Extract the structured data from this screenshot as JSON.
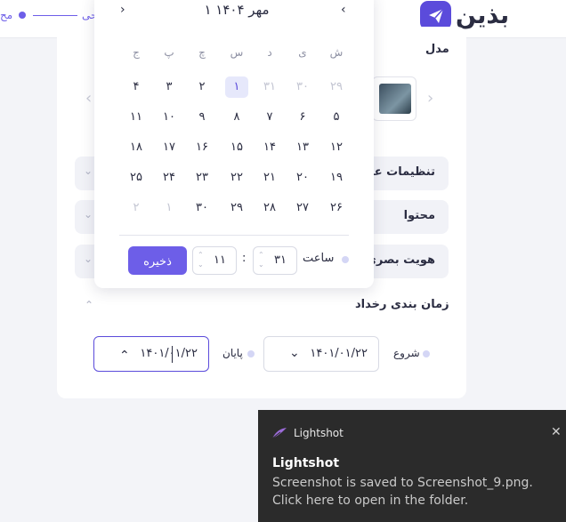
{
  "header": {
    "logo_text": "بذین",
    "step_label_active": "حی",
    "step_label_next": "مح"
  },
  "form": {
    "model_label": "مدل",
    "accordions": [
      {
        "title": "تنظیمات عم"
      },
      {
        "title": "محتوا"
      },
      {
        "title": "هویت بصری"
      }
    ],
    "schedule_title": "زمان بندی رخداد",
    "start_label": "شروع",
    "start_value": "۱۴۰۱/۰۱/۲۲",
    "end_label": "پایان",
    "end_value": "۱۴۰۱/۰۱/۲۲"
  },
  "calendar": {
    "title": "۱ مهر ۱۴۰۴",
    "prev_icon": "›",
    "next_icon": "‹",
    "weekdays": [
      "ش",
      "ی",
      "د",
      "س",
      "چ",
      "پ",
      "ج"
    ],
    "weeks": [
      [
        "۲۹",
        "۳۰",
        "۳۱",
        "۱",
        "۲",
        "۳",
        "۴"
      ],
      [
        "۵",
        "۶",
        "۷",
        "۸",
        "۹",
        "۱۰",
        "۱۱"
      ],
      [
        "۱۲",
        "۱۳",
        "۱۴",
        "۱۵",
        "۱۶",
        "۱۷",
        "۱۸"
      ],
      [
        "۱۹",
        "۲۰",
        "۲۱",
        "۲۲",
        "۲۳",
        "۲۴",
        "۲۵"
      ],
      [
        "۲۶",
        "۲۷",
        "۲۸",
        "۲۹",
        "۳۰",
        "۱",
        "۲"
      ]
    ],
    "selected_day": "۱",
    "time_label": "ساعت",
    "minute_value": "۳۱",
    "hour_value": "۱۱",
    "time_separator": ":",
    "save_label": "ذخیره"
  },
  "toast": {
    "app_name": "Lightshot",
    "title": "Lightshot",
    "message": "Screenshot is saved to Screenshot_9.png. Click here to open in the folder."
  },
  "colors": {
    "accent": "#6d5ee8",
    "brand": "#5b4bdb",
    "toast_bg": "#2b2b2b"
  }
}
